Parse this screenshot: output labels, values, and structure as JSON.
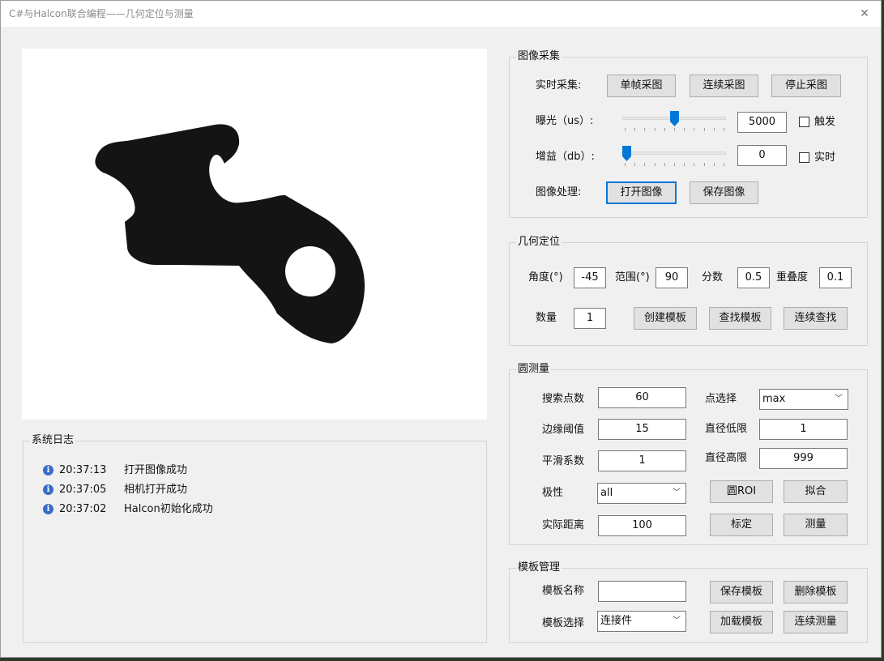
{
  "window": {
    "title": "C#与Halcon联合编程——几何定位与测量"
  },
  "image_acquisition": {
    "title": "图像采集",
    "realtime_label": "实时采集:",
    "single_frame": "单帧采图",
    "continuous": "连续采图",
    "stop": "停止采图",
    "exposure_label": "曝光（us）:",
    "exposure_value": "5000",
    "exposure_slider_fraction": 0.5,
    "trigger_label": "触发",
    "gain_label": "增益（db）:",
    "gain_value": "0",
    "gain_slider_fraction": 0.0,
    "realtime_check_label": "实时",
    "processing_label": "图像处理:",
    "open_image": "打开图像",
    "save_image": "保存图像"
  },
  "geometric_location": {
    "title": "几何定位",
    "angle_label": "角度(°)",
    "angle_value": "-45",
    "range_label": "范围(°)",
    "range_value": "90",
    "score_label": "分数",
    "score_value": "0.5",
    "overlap_label": "重叠度",
    "overlap_value": "0.1",
    "count_label": "数量",
    "count_value": "1",
    "create_model": "创建模板",
    "find_model": "查找模板",
    "continuous_find": "连续查找"
  },
  "circle_measure": {
    "title": "圆测量",
    "search_points_label": "搜索点数",
    "search_points_value": "60",
    "point_select_label": "点选择",
    "point_select_value": "max",
    "edge_threshold_label": "边缘阈值",
    "edge_threshold_value": "15",
    "diameter_low_label": "直径低限",
    "diameter_low_value": "1",
    "smooth_label": "平滑系数",
    "smooth_value": "1",
    "diameter_high_label": "直径高限",
    "diameter_high_value": "999",
    "polarity_label": "极性",
    "polarity_value": "all",
    "circle_roi": "圆ROI",
    "fit": "拟合",
    "distance_label": "实际距离",
    "distance_value": "100",
    "calibrate": "标定",
    "measure": "测量"
  },
  "model_management": {
    "title": "模板管理",
    "name_label": "模板名称",
    "name_value": "",
    "save_model": "保存模板",
    "delete_model": "删除模板",
    "select_label": "模板选择",
    "select_value": "连接件",
    "load_model": "加载模板",
    "continuous_measure": "连续测量"
  },
  "system_log": {
    "title": "系统日志",
    "entries": [
      {
        "time": "20:37:13",
        "message": "打开图像成功"
      },
      {
        "time": "20:37:05",
        "message": "相机打开成功"
      },
      {
        "time": "20:37:02",
        "message": "Halcon初始化成功"
      }
    ]
  },
  "colors": {
    "accent": "#0078d7",
    "info_icon": "#3a6bc8",
    "part": "#141414"
  }
}
